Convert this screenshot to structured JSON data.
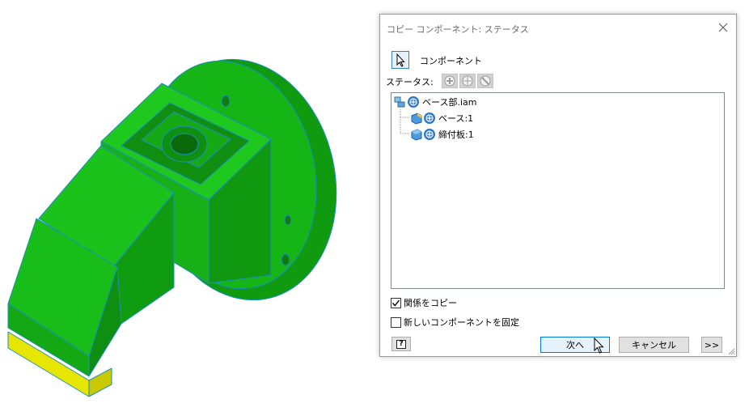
{
  "dialog": {
    "title": "コピー コンポーネント: ステータス",
    "select_label": "コンポーネント",
    "status_label": "ステータス:",
    "status_icons": [
      "copy-status-icon",
      "reuse-status-icon",
      "exclude-status-icon"
    ],
    "tree": [
      {
        "label": "ベース部.iam",
        "icon": "assembly-icon",
        "level": 0
      },
      {
        "label": "ベース:1",
        "icon": "part-icon",
        "level": 1
      },
      {
        "label": "締付板:1",
        "icon": "part-icon",
        "level": 1
      }
    ],
    "options": {
      "copy_relations_label": "関係をコピー",
      "copy_relations_checked": true,
      "ground_new_label": "新しいコンポーネントを固定",
      "ground_new_checked": false
    },
    "buttons": {
      "help": "?",
      "next": "次へ",
      "cancel": "キャンセル",
      "more": ">>"
    }
  },
  "colors": {
    "model_green": "#12c012",
    "model_edge": "#1a8fc0",
    "model_yellow": "#e6e600",
    "accent": "#0078d7"
  }
}
